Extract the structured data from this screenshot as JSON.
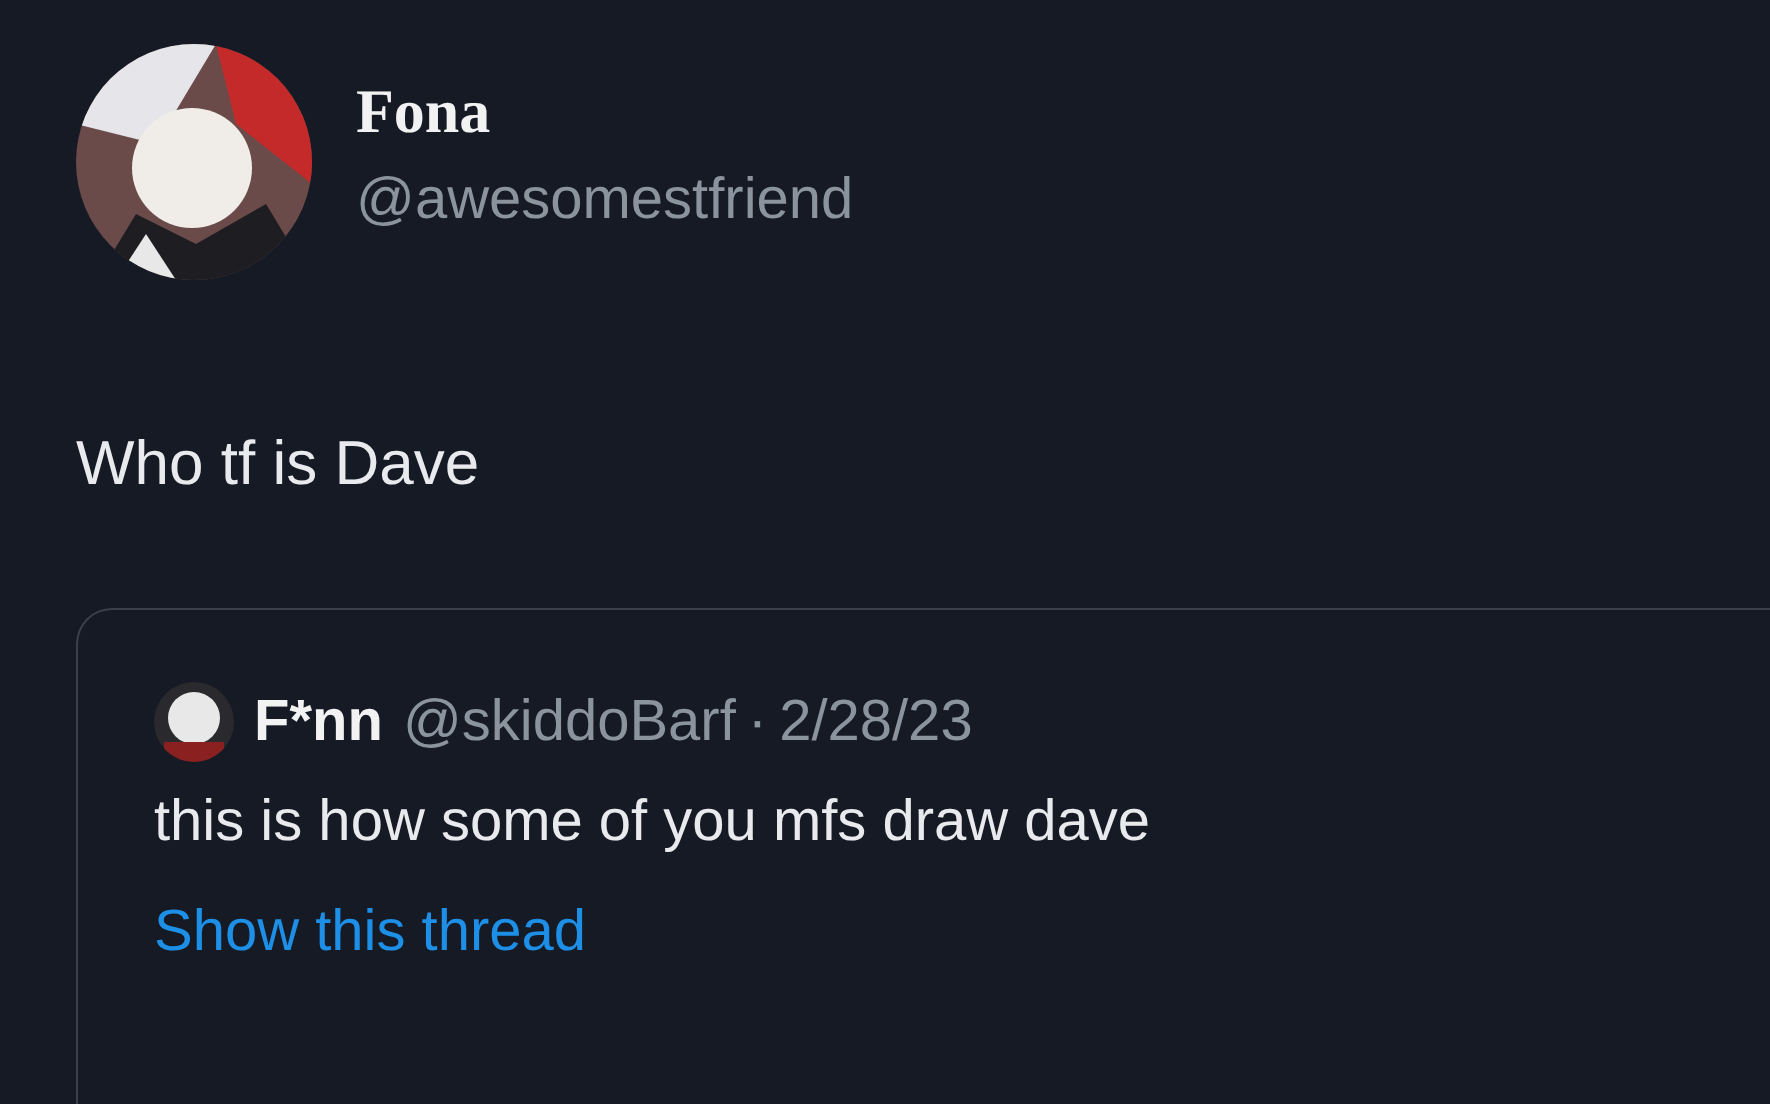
{
  "tweet": {
    "author": {
      "name": "Fona",
      "handle": "@awesomestfriend"
    },
    "text": "Who tf is Dave",
    "quote": {
      "author": {
        "name": "F*nn",
        "handle": "@skiddoBarf"
      },
      "separator": "·",
      "date": "2/28/23",
      "text": "this is how some of you mfs draw dave",
      "link": "Show this thread"
    }
  }
}
